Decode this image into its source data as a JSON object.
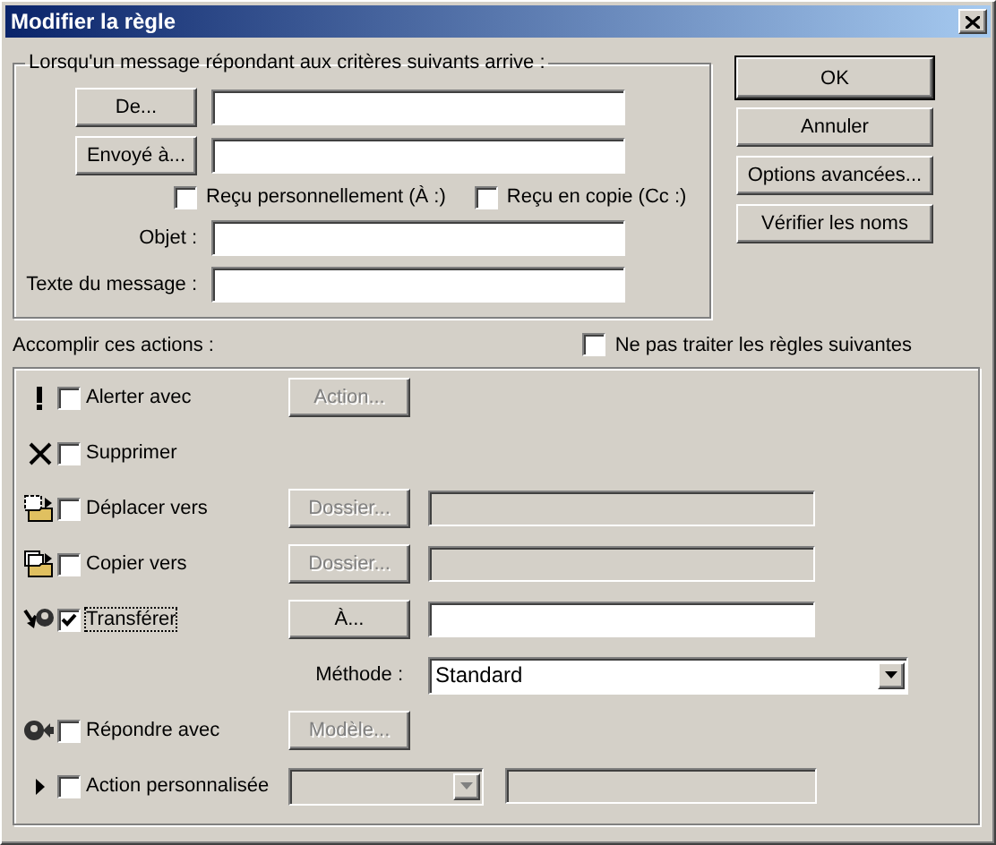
{
  "window": {
    "title": "Modifier la règle"
  },
  "criteria": {
    "legend": "Lorsqu'un message répondant aux critères suivants arrive :",
    "address_rows": [
      {
        "button": "De..."
      },
      {
        "button": "Envoyé à..."
      }
    ],
    "recipient_checks": [
      {
        "label": "Reçu personnellement (À :)",
        "checked": false
      },
      {
        "label": "Reçu en copie (Cc :)",
        "checked": false
      }
    ],
    "text_rows": [
      {
        "label": "Objet :"
      },
      {
        "label": "Texte du message :"
      }
    ]
  },
  "buttons": [
    {
      "label": "OK",
      "default": true
    },
    {
      "label": "Annuler",
      "default": false
    },
    {
      "label": "Options avancées...",
      "default": false
    },
    {
      "label": "Vérifier les noms",
      "default": false
    }
  ],
  "actions": {
    "title": "Accomplir ces actions :",
    "stop_rules": {
      "label": "Ne pas traiter les règles suivantes",
      "checked": false
    },
    "items": [
      {
        "label": "Alerter avec",
        "checked": false,
        "focused": false,
        "button": {
          "label": "Action...",
          "disabled": true
        }
      },
      {
        "label": "Supprimer",
        "checked": false,
        "focused": false
      },
      {
        "label": "Déplacer vers",
        "checked": false,
        "focused": false,
        "button": {
          "label": "Dossier...",
          "disabled": true
        },
        "field": {
          "disabled": true
        }
      },
      {
        "label": "Copier vers",
        "checked": false,
        "focused": false,
        "button": {
          "label": "Dossier...",
          "disabled": true
        },
        "field": {
          "disabled": true
        }
      },
      {
        "label": "Transférer",
        "checked": true,
        "focused": true,
        "button": {
          "label": "À...",
          "disabled": false
        },
        "field": {
          "disabled": false
        },
        "method": {
          "label": "Méthode :",
          "value": "Standard"
        }
      },
      {
        "label": "Répondre avec",
        "checked": false,
        "focused": false,
        "button": {
          "label": "Modèle...",
          "disabled": true
        }
      },
      {
        "label": "Action personnalisée",
        "checked": false,
        "focused": false,
        "combo": {
          "disabled": true
        },
        "field": {
          "disabled": true
        }
      }
    ]
  }
}
